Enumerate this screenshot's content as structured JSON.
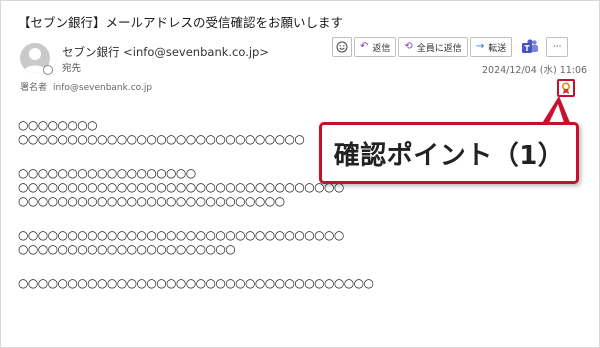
{
  "email": {
    "subject": "【セブン銀行】メールアドレスの受信確認をお願いします",
    "sender": "セブン銀行 <info@sevenbank.co.jp>",
    "recipient_label": "宛先",
    "signer_label": "署名者",
    "signer_address": "info@sevenbank.co.jp",
    "datetime": "2024/12/04 (水) 11:06"
  },
  "toolbar": {
    "emoji_icon": "smiley-icon",
    "reply_label": "返信",
    "reply_all_label": "全員に返信",
    "forward_label": "転送",
    "teams_icon": "teams-icon",
    "more_label": "···"
  },
  "body": {
    "lines": [
      "○○○○○○○○",
      "○○○○○○○○○○○○○○○○○○○○○○○○○○○○○",
      "",
      "○○○○○○○○○○○○○○○○○○",
      "○○○○○○○○○○○○○○○○○○○○○○○○○○○○○○○○○",
      "○○○○○○○○○○○○○○○○○○○○○○○○○○○",
      "",
      "○○○○○○○○○○○○○○○○○○○○○○○○○○○○○○○○○",
      "○○○○○○○○○○○○○○○○○○○○○○",
      "",
      "○○○○○○○○○○○○○○○○○○○○○○○○○○○○○○○○○○○○"
    ]
  },
  "callout": {
    "text": "確認ポイント（1）",
    "color": "#c8102e"
  }
}
